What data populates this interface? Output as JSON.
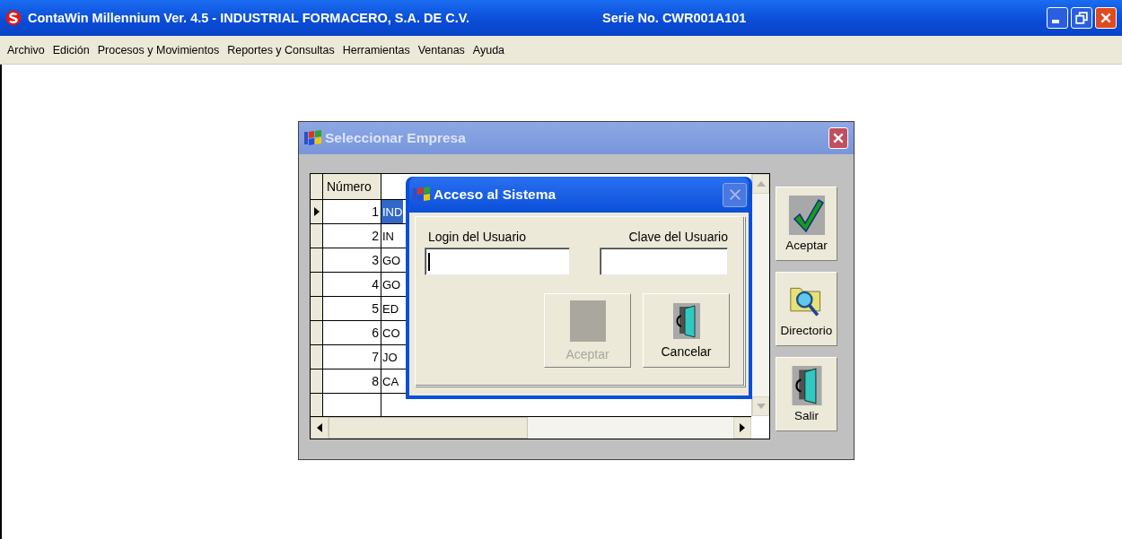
{
  "window": {
    "title": "ContaWin Millennium Ver. 4.5 - INDUSTRIAL FORMACERO, S.A. DE C.V.",
    "serial": "Serie No.  CWR001A101"
  },
  "menu": [
    "Archivo",
    "Edición",
    "Procesos y Movimientos",
    "Reportes y Consultas",
    "Herramientas",
    "Ventanas",
    "Ayuda"
  ],
  "select_dialog": {
    "title": "Seleccionar Empresa",
    "grid": {
      "columns": [
        "Número"
      ],
      "rows": [
        {
          "number": "1",
          "name": "IND",
          "selected": true
        },
        {
          "number": "2",
          "name": "IN",
          "selected": false
        },
        {
          "number": "3",
          "name": "GO",
          "selected": false
        },
        {
          "number": "4",
          "name": "GO",
          "selected": false
        },
        {
          "number": "5",
          "name": "ED",
          "selected": false
        },
        {
          "number": "6",
          "name": "CO",
          "selected": false
        },
        {
          "number": "7",
          "name": "JO",
          "selected": false
        },
        {
          "number": "8",
          "name": "CA",
          "selected": false
        }
      ]
    },
    "buttons": [
      {
        "label": "Aceptar",
        "kind": "check"
      },
      {
        "label": "Directorio",
        "kind": "folder"
      },
      {
        "label": "Salir",
        "kind": "door"
      }
    ]
  },
  "login_dialog": {
    "title": "Acceso al Sistema",
    "fields": [
      {
        "label": "Login del Usuario",
        "focused": true
      },
      {
        "label": "Clave del Usuario",
        "focused": false
      }
    ],
    "buttons": [
      {
        "label": "Aceptar",
        "disabled": true,
        "kind": "blank"
      },
      {
        "label": "Cancelar",
        "disabled": false,
        "kind": "door"
      }
    ]
  }
}
